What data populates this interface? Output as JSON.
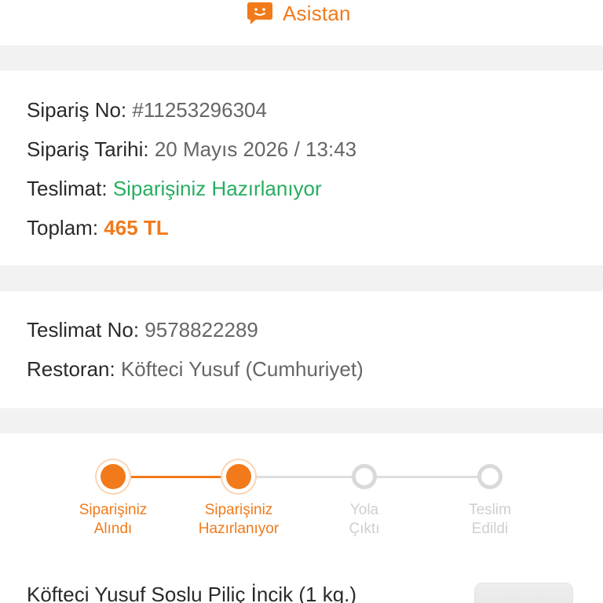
{
  "assistant": {
    "label": "Asistan",
    "icon": "chat-bubble-icon",
    "color": "#f27a1a"
  },
  "order": {
    "number_label": "Sipariş No:",
    "number_value": "#11253296304",
    "date_label": "Sipariş Tarihi:",
    "date_value": "20 Mayıs 2026 / 13:43",
    "delivery_label": "Teslimat:",
    "delivery_value": "Siparişiniz Hazırlanıyor",
    "total_label": "Toplam:",
    "total_value": "465 TL"
  },
  "delivery": {
    "number_label": "Teslimat No:",
    "number_value": "9578822289",
    "restaurant_label": "Restoran:",
    "restaurant_value": "Köfteci Yusuf (Cumhuriyet)"
  },
  "tracker": {
    "steps": [
      {
        "line1": "Siparişiniz",
        "line2": "Alındı",
        "state": "done"
      },
      {
        "line1": "Siparişiniz",
        "line2": "Hazırlanıyor",
        "state": "done"
      },
      {
        "line1": "Yola",
        "line2": "Çıktı",
        "state": "pending"
      },
      {
        "line1": "Teslim",
        "line2": "Edildi",
        "state": "pending"
      }
    ],
    "active_color": "#f27a1a",
    "inactive_color": "#d9d9d9"
  },
  "product": {
    "title": "Köfteci Yusuf Soslu Piliç İncik (1 kg.)"
  },
  "colors": {
    "accent": "#f27a1a",
    "success": "#27ae60",
    "separator": "#f2f2f2"
  }
}
